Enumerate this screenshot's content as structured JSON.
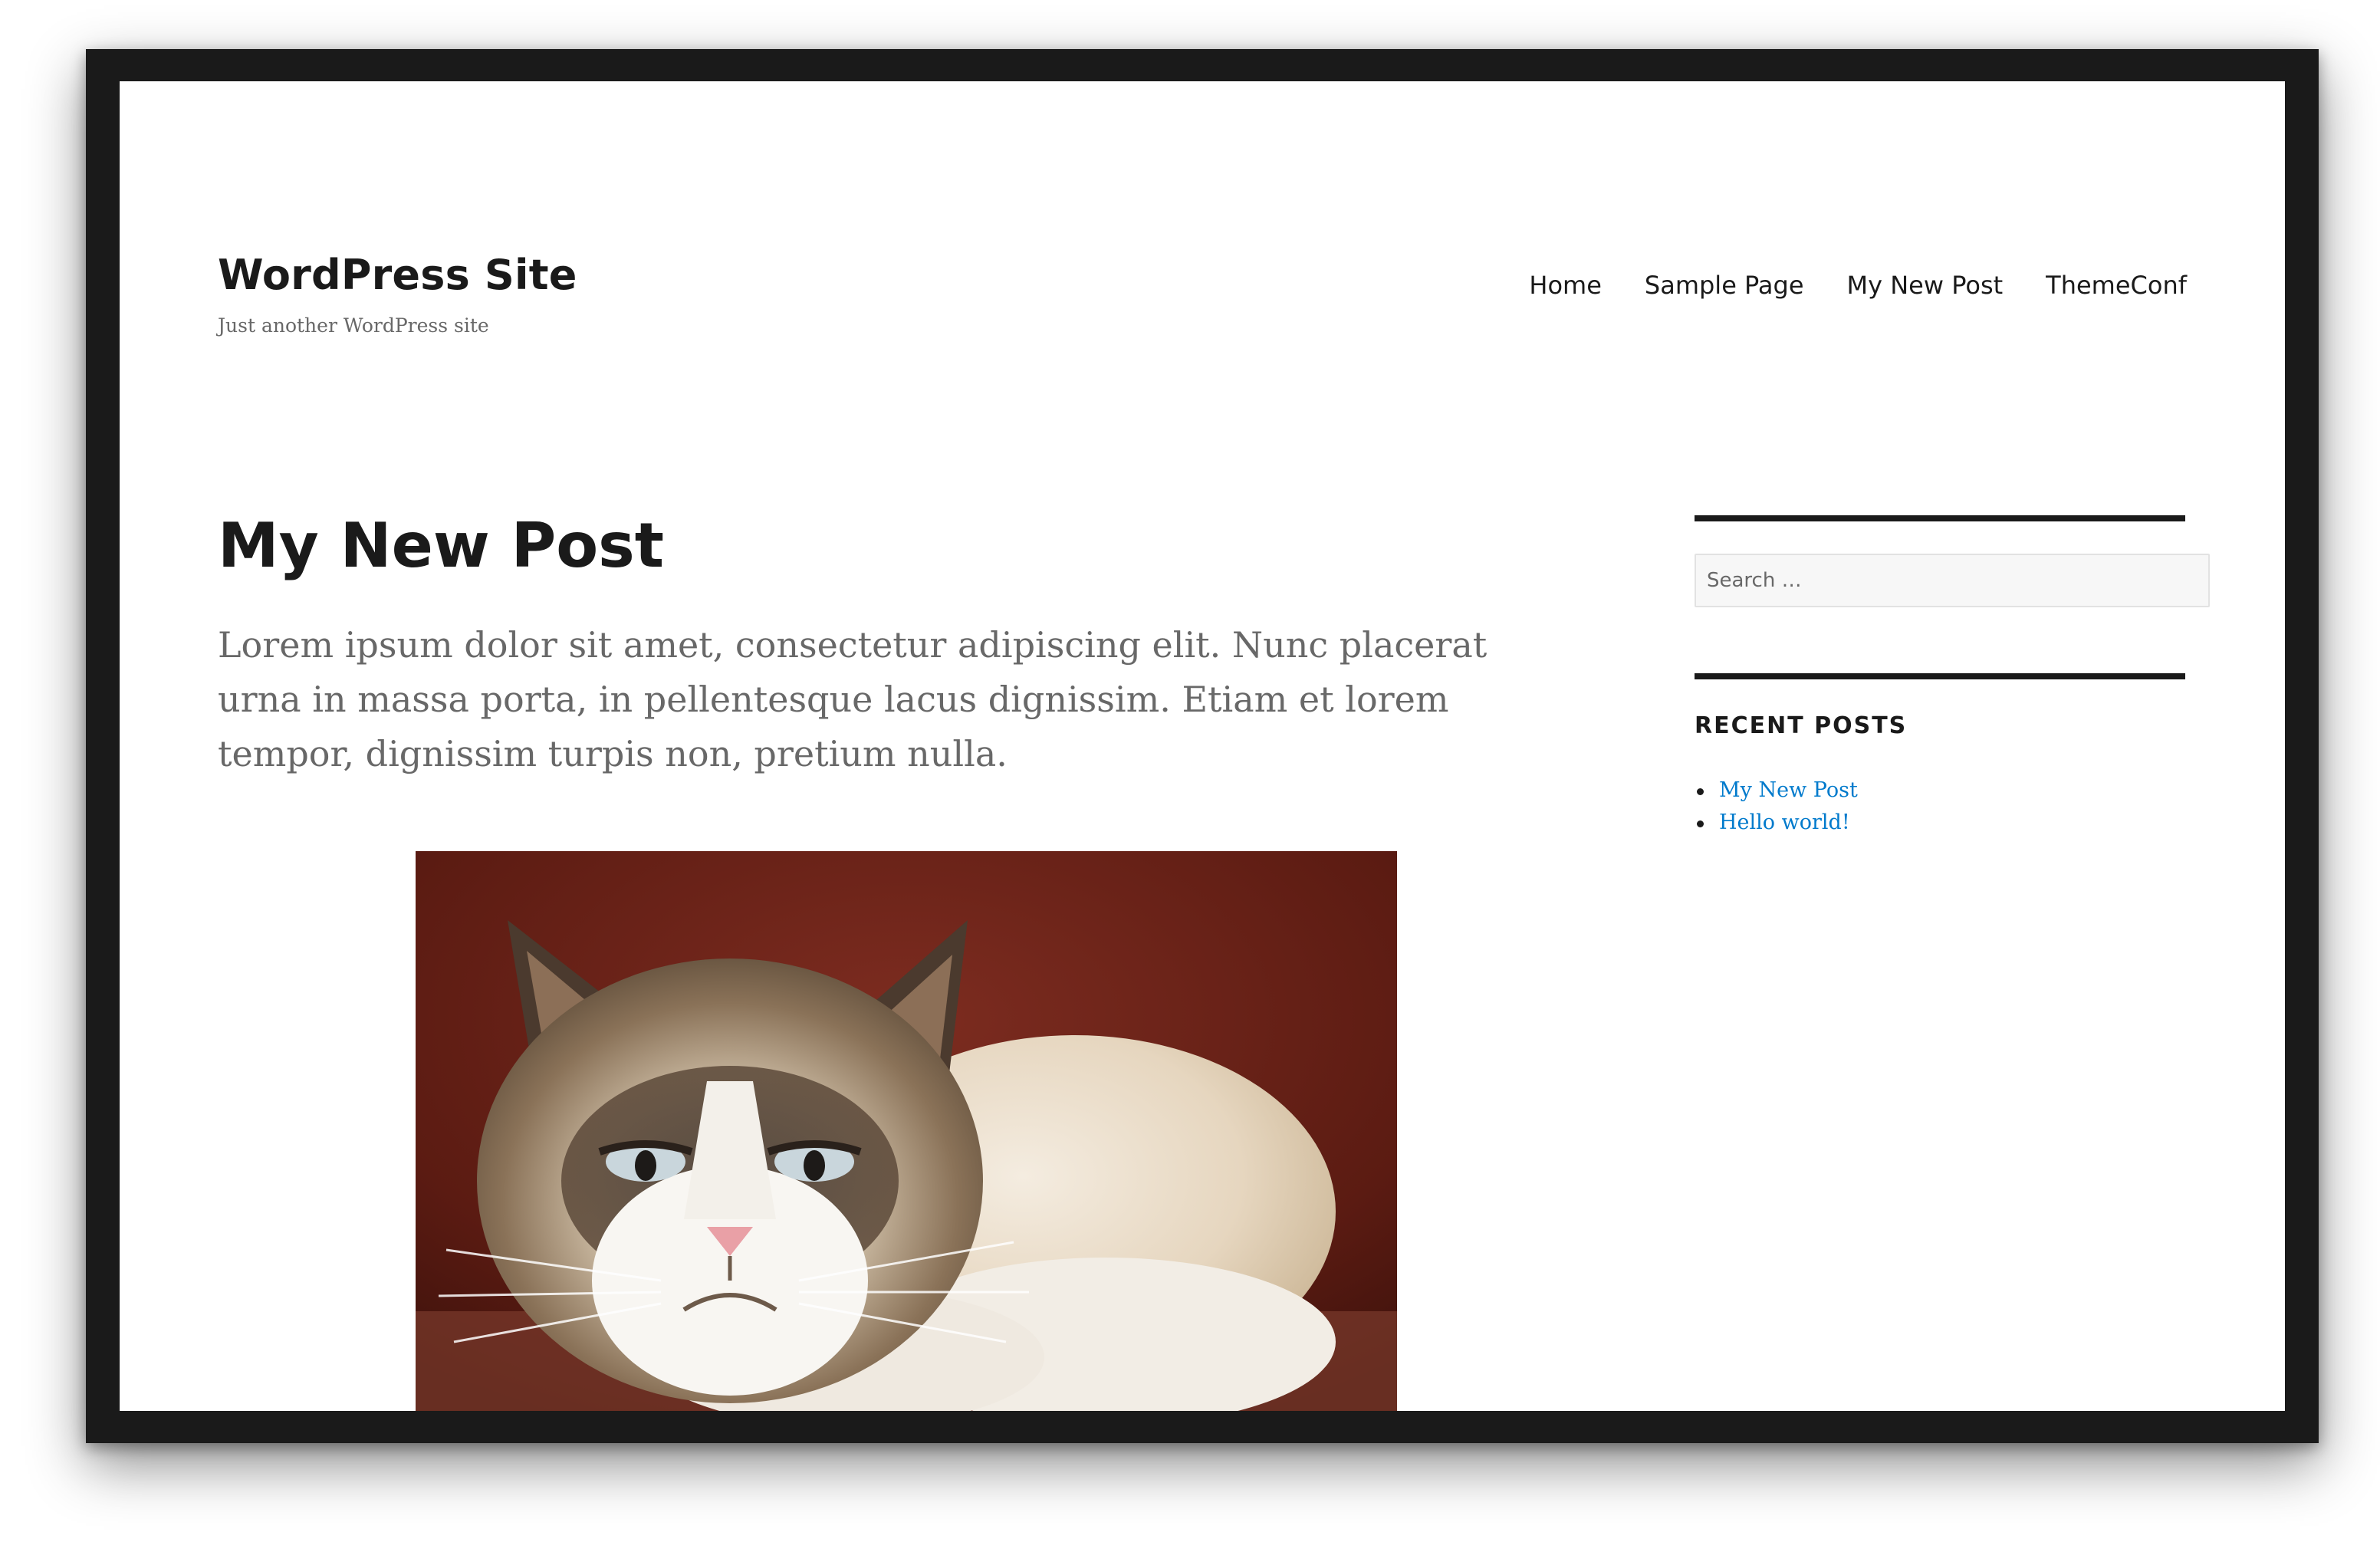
{
  "header": {
    "site_title": "WordPress Site",
    "tagline": "Just another WordPress site",
    "nav": [
      {
        "label": "Home"
      },
      {
        "label": "Sample Page"
      },
      {
        "label": "My New Post"
      },
      {
        "label": "ThemeConf"
      }
    ]
  },
  "post": {
    "title": "My New Post",
    "excerpt": "Lorem ipsum dolor sit amet, consectetur adipiscing elit. Nunc placerat urna in massa porta, in pellentesque lacus dignissim. Etiam et lorem tempor, dignissim turpis non, pretium nulla."
  },
  "sidebar": {
    "search": {
      "placeholder": "Search …",
      "value": ""
    },
    "recent_posts": {
      "title": "RECENT POSTS",
      "items": [
        {
          "label": "My New Post"
        },
        {
          "label": "Hello world!"
        }
      ]
    }
  },
  "colors": {
    "text": "#1a1a1a",
    "muted": "#686868",
    "link": "#007acc",
    "frame": "#1a1a1a"
  }
}
